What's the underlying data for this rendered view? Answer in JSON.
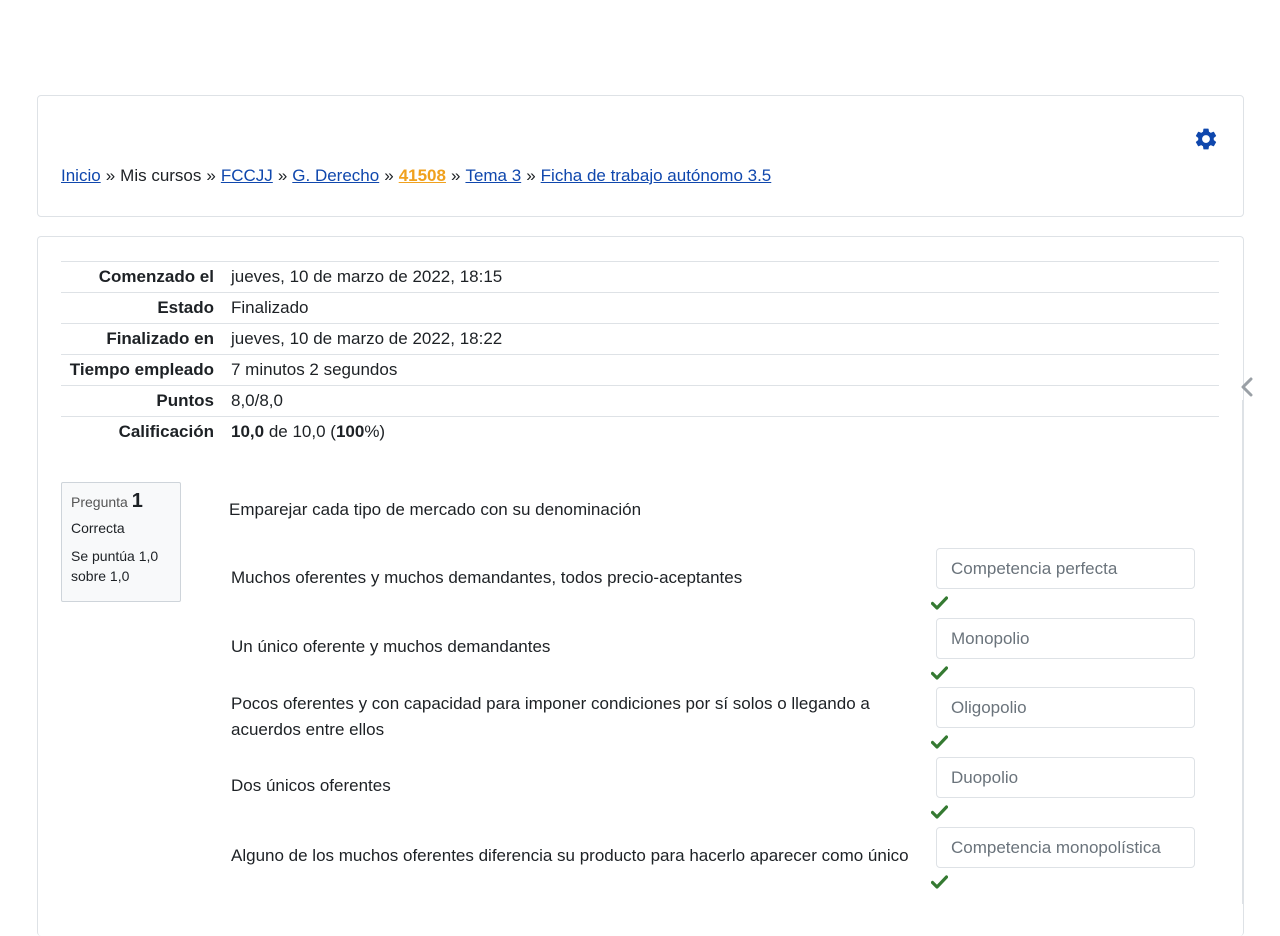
{
  "breadcrumb": {
    "items": [
      "Inicio",
      "Mis cursos",
      "FCCJJ",
      "G. Derecho",
      "41508",
      "Tema 3",
      "Ficha de trabajo autónomo 3.5"
    ],
    "separator": "»"
  },
  "summary": {
    "rows": [
      {
        "label": "Comenzado el",
        "value": "jueves, 10 de marzo de 2022, 18:15"
      },
      {
        "label": "Estado",
        "value": "Finalizado"
      },
      {
        "label": "Finalizado en",
        "value": "jueves, 10 de marzo de 2022, 18:22"
      },
      {
        "label": "Tiempo empleado",
        "value": "7 minutos 2 segundos"
      },
      {
        "label": "Puntos",
        "value": "8,0/8,0"
      },
      {
        "label": "Calificación",
        "grade": "10,0",
        "of_text": "de 10,0 (",
        "percent": "100",
        "suffix": "%)"
      }
    ]
  },
  "question": {
    "label": "Pregunta",
    "number": "1",
    "state": "Correcta",
    "grade_text": "Se puntúa 1,0 sobre 1,0",
    "text": "Emparejar cada tipo de mercado con su denominación",
    "rows": [
      {
        "text": "Muchos oferentes y muchos demandantes, todos precio-aceptantes",
        "answer": "Competencia perfecta"
      },
      {
        "text": "Un único oferente y muchos demandantes",
        "answer": "Monopolio"
      },
      {
        "text": "Pocos oferentes y con capacidad para imponer condiciones por sí solos o llegando a acuerdos entre ellos",
        "answer": "Oligopolio"
      },
      {
        "text": "Dos únicos oferentes",
        "answer": "Duopolio"
      },
      {
        "text": "Alguno de los muchos oferentes diferencia su producto para hacerlo aparecer como único",
        "answer": "Competencia monopolística"
      }
    ]
  },
  "icons": {
    "settings": "gear-icon",
    "correct": "check-icon",
    "drawer": "chevron-left-icon"
  },
  "colors": {
    "link": "#0f47ad",
    "highlight": "#f0a11d",
    "check": "#357a32",
    "gear": "#0f47ad"
  }
}
